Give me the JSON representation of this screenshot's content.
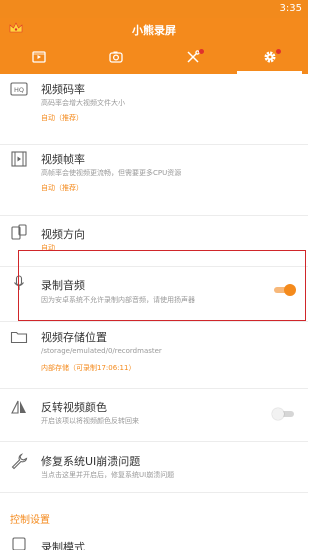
{
  "status_bar": {
    "time": "3:35"
  },
  "app": {
    "title": "小熊录屏"
  },
  "tabs": [
    {
      "icon": "film-icon"
    },
    {
      "icon": "camera-icon"
    },
    {
      "icon": "tools-icon"
    },
    {
      "icon": "gear-icon"
    }
  ],
  "settings": [
    {
      "title": "视频码率",
      "subtitle": "高码率会增大视频文件大小",
      "value": "自动（推荐）",
      "icon": "hq-icon"
    },
    {
      "title": "视频帧率",
      "subtitle": "高帧率会使视频更流畅，但需要更多CPU资源",
      "value": "自动（推荐）",
      "icon": "film-strip-icon"
    },
    {
      "title": "视频方向",
      "subtitle": "",
      "value": "自动",
      "icon": "phone-rotate-icon"
    },
    {
      "title": "录制音频",
      "subtitle": "因为安卓系统不允许录制内部音频，请使用扬声器",
      "value": "",
      "icon": "microphone-icon",
      "toggle": true
    },
    {
      "title": "视频存储位置",
      "subtitle": "/storage/emulated/0/recordmaster",
      "value": "内部存储（可录制17:06:11）",
      "icon": "folder-icon"
    },
    {
      "title": "反转视频颜色",
      "subtitle": "开启该项以将视频颜色反转回来",
      "value": "",
      "icon": "flip-icon",
      "toggle": false
    },
    {
      "title": "修复系统UI崩溃问题",
      "subtitle": "当点击这里并开启后，修复系统UI崩溃问题",
      "value": "",
      "icon": "wrench-icon"
    }
  ],
  "section": {
    "label": "控制设置"
  },
  "next_item": {
    "title": "录制模式"
  },
  "colors": {
    "accent": "#f48a1c",
    "highlight": "#d0262a"
  }
}
